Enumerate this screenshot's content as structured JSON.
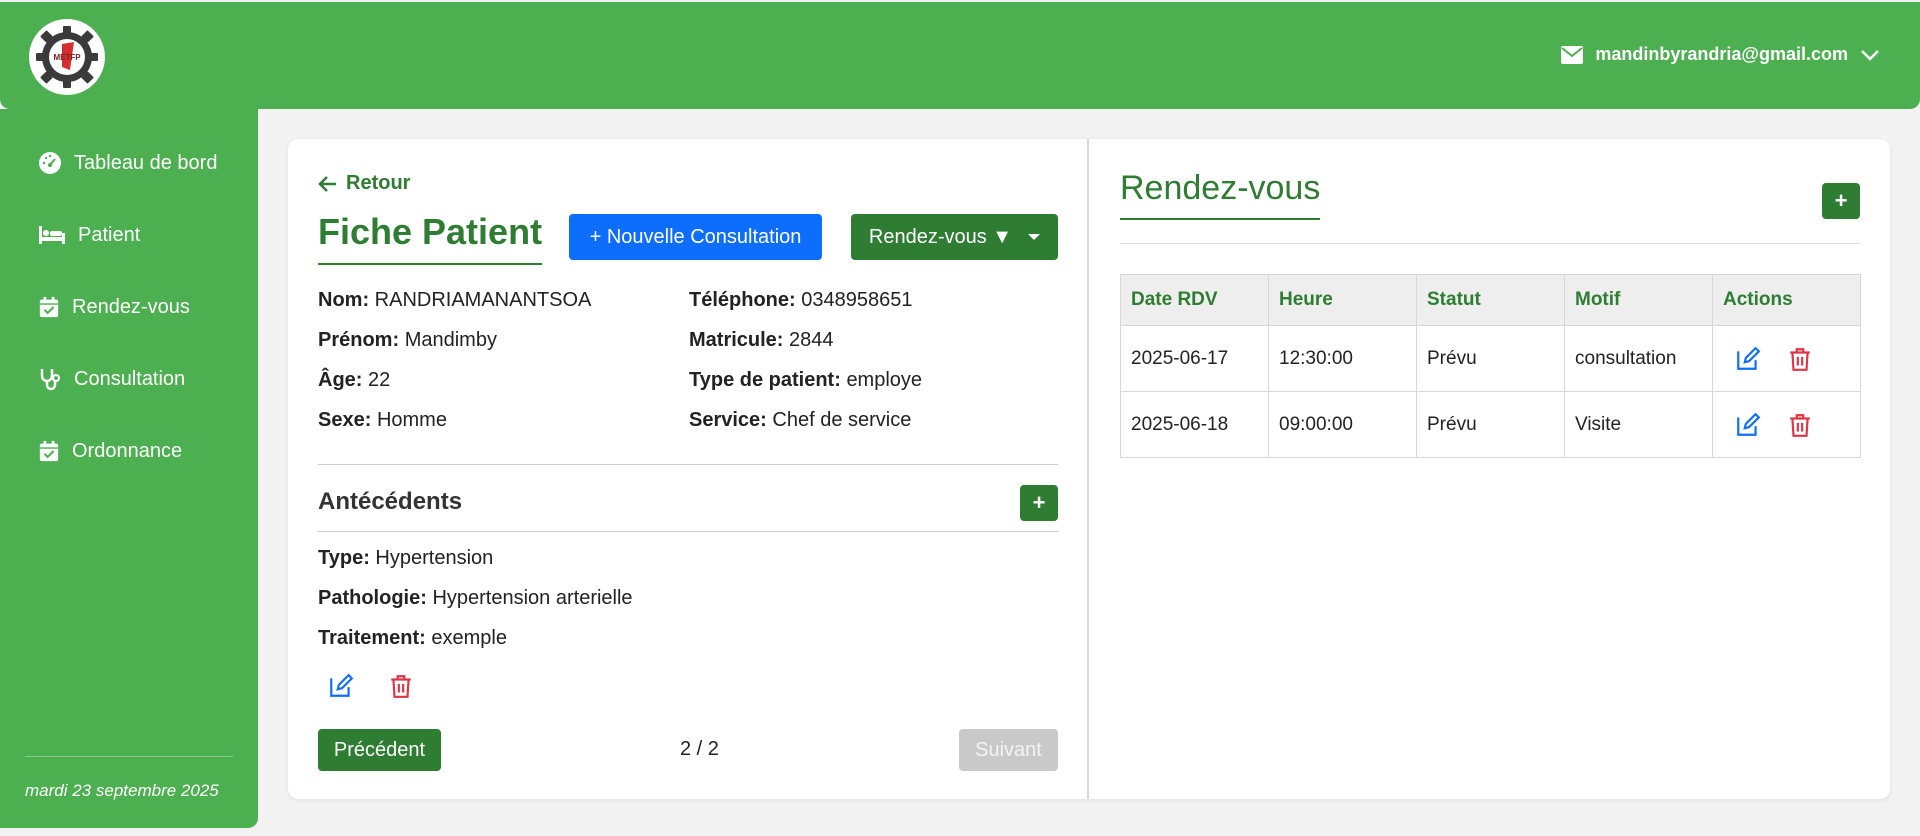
{
  "header": {
    "logo_text": "METFP",
    "user_email": "mandinbyrandria@gmail.com",
    "icons": {
      "mail": "envelope-icon",
      "dropdown": "chevron-down-icon"
    }
  },
  "sidebar": {
    "items": [
      {
        "label": "Tableau de bord",
        "icon": "gauge-icon"
      },
      {
        "label": "Patient",
        "icon": "bed-icon"
      },
      {
        "label": "Rendez-vous",
        "icon": "calendar-check-icon"
      },
      {
        "label": "Consultation",
        "icon": "stethoscope-icon"
      },
      {
        "label": "Ordonnance",
        "icon": "calendar-check-icon"
      }
    ],
    "date": "mardi 23 septembre 2025"
  },
  "patient": {
    "back_label": "Retour",
    "title": "Fiche Patient",
    "new_consultation_label": "+ Nouvelle Consultation",
    "rdv_dropdown_label": "Rendez-vous ▼",
    "fields": {
      "nom_label": "Nom:",
      "nom": "RANDRIAMANANTSOA",
      "prenom_label": "Prénom:",
      "prenom": "Mandimby",
      "age_label": "Âge:",
      "age": "22",
      "sexe_label": "Sexe:",
      "sexe": "Homme",
      "tel_label": "Téléphone:",
      "tel": "0348958651",
      "matricule_label": "Matricule:",
      "matricule": "2844",
      "type_label": "Type de patient:",
      "type": "employe",
      "service_label": "Service:",
      "service": "Chef de service"
    }
  },
  "antecedents": {
    "title": "Antécédents",
    "add_label": "+",
    "type_label": "Type:",
    "type": "Hypertension",
    "pathologie_label": "Pathologie:",
    "pathologie": "Hypertension arterielle",
    "traitement_label": "Traitement:",
    "traitement": "exemple",
    "prev_label": "Précédent",
    "page_indicator": "2 / 2",
    "next_label": "Suivant"
  },
  "rendezvous": {
    "title": "Rendez-vous",
    "add_label": "+",
    "columns": [
      "Date RDV",
      "Heure",
      "Statut",
      "Motif",
      "Actions"
    ],
    "rows": [
      {
        "date": "2025-06-17",
        "heure": "12:30:00",
        "statut": "Prévu",
        "motif": "consultation"
      },
      {
        "date": "2025-06-18",
        "heure": "09:00:00",
        "statut": "Prévu",
        "motif": "Visite"
      }
    ]
  },
  "colors": {
    "primary_green": "#4caf50",
    "dark_green": "#2e7d32",
    "blue": "#0d6efd",
    "edit_blue": "#0d6efd",
    "delete_red": "#dc3545",
    "disabled_gray": "#c9c9c9"
  }
}
